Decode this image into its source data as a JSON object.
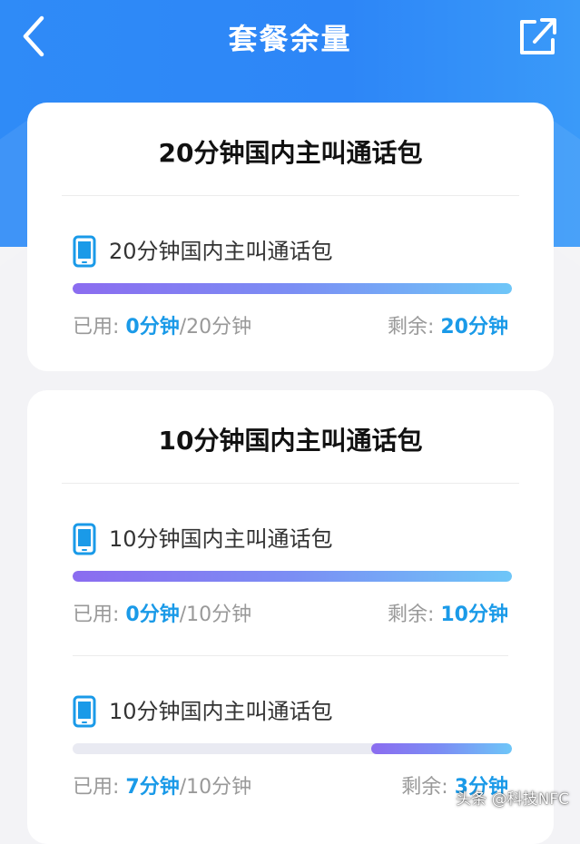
{
  "header": {
    "title": "套餐余量"
  },
  "icons": {
    "back": "chevron-left-icon",
    "share": "share-external-icon",
    "phone": "mobile-phone-icon"
  },
  "colors": {
    "header_blue": "#2f8bf7",
    "accent_text": "#1a9ae8",
    "bar_start": "#8b6cf0",
    "bar_end": "#6ec6f8"
  },
  "labels": {
    "used": "已用: ",
    "remaining": "剩余: "
  },
  "cards": [
    {
      "title": "20分钟国内主叫通话包",
      "items": [
        {
          "name": "20分钟国内主叫通话包",
          "used_value": "0分钟",
          "total_suffix": "/20分钟",
          "remaining_value": "20分钟",
          "remaining_fraction": 1.0
        }
      ]
    },
    {
      "title": "10分钟国内主叫通话包",
      "items": [
        {
          "name": "10分钟国内主叫通话包",
          "used_value": "0分钟",
          "total_suffix": "/10分钟",
          "remaining_value": "10分钟",
          "remaining_fraction": 1.0
        },
        {
          "name": "10分钟国内主叫通话包",
          "used_value": "7分钟",
          "total_suffix": "/10分钟",
          "remaining_value": "3分钟",
          "remaining_fraction": 0.32
        }
      ]
    }
  ],
  "watermark": "头条 @科技NFC"
}
